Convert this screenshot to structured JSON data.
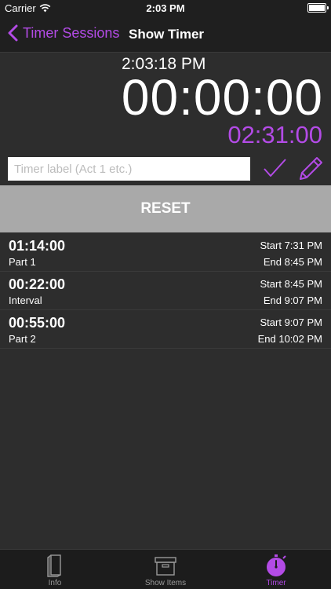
{
  "status_bar": {
    "carrier": "Carrier",
    "time": "2:03 PM"
  },
  "nav": {
    "back_label": "Timer Sessions",
    "title": "Show Timer"
  },
  "timer": {
    "clock": "2:03:18 PM",
    "elapsed": "00:00:00",
    "target": "02:31:00"
  },
  "label_input": {
    "placeholder": "Timer label (Act 1 etc.)",
    "value": ""
  },
  "reset_label": "RESET",
  "sessions": [
    {
      "duration": "01:14:00",
      "name": "Part 1",
      "start": "Start 7:31 PM",
      "end": "End 8:45 PM"
    },
    {
      "duration": "00:22:00",
      "name": "Interval",
      "start": "Start 8:45 PM",
      "end": "End 9:07 PM"
    },
    {
      "duration": "00:55:00",
      "name": "Part 2",
      "start": "Start 9:07 PM",
      "end": "End 10:02 PM"
    }
  ],
  "tabs": [
    {
      "label": "Info",
      "icon": "book-icon"
    },
    {
      "label": "Show Items",
      "icon": "box-icon"
    },
    {
      "label": "Timer",
      "icon": "stopwatch-icon"
    }
  ],
  "colors": {
    "accent": "#b34be6",
    "background": "#2d2d2d",
    "bar": "#1f1f1f",
    "reset": "#a9a9a9"
  }
}
